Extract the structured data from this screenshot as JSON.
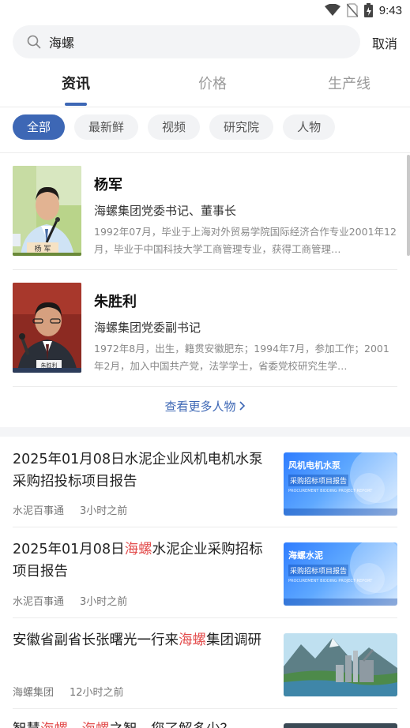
{
  "status_bar": {
    "time": "9:43",
    "icons": [
      "wifi-icon",
      "no-sim-icon",
      "battery-charging-icon"
    ]
  },
  "search": {
    "value": "海螺",
    "cancel_label": "取消"
  },
  "main_tabs": [
    {
      "label": "资讯",
      "active": true
    },
    {
      "label": "价格",
      "active": false
    },
    {
      "label": "生产线",
      "active": false
    }
  ],
  "filter_chips": [
    {
      "label": "全部",
      "active": true
    },
    {
      "label": "最新鲜",
      "active": false
    },
    {
      "label": "视频",
      "active": false
    },
    {
      "label": "研究院",
      "active": false
    },
    {
      "label": "人物",
      "active": false
    }
  ],
  "people": [
    {
      "name": "杨军",
      "title": "海螺集团党委书记、董事长",
      "bio": "1992年07月，毕业于上海对外贸易学院国际经济合作专业2001年12月，毕业于中国科技大学工商管理专业，获得工商管理…",
      "photo_caption": "杨 军"
    },
    {
      "name": "朱胜利",
      "title": "海螺集团党委副书记",
      "bio": "1972年8月，出生，籍贯安徽肥东；1994年7月，参加工作；2001年2月，加入中国共产党，法学学士，省委党校研究生学…",
      "photo_caption": "朱胜利"
    }
  ],
  "more_people_label": "查看更多人物",
  "news": [
    {
      "title_parts": [
        {
          "text": "2025年01月08日水泥企业风机电机水泵采购招投标项目报告",
          "highlight": false
        }
      ],
      "source": "水泥百事通",
      "time": "3小时之前",
      "thumb": {
        "line1": "风机电机水泵",
        "badge": "采购招标项目报告",
        "line3": "PROCUREMENT BIDDING PROJECT REPORT"
      }
    },
    {
      "title_parts": [
        {
          "text": "2025年01月08日",
          "highlight": false
        },
        {
          "text": "海螺",
          "highlight": true
        },
        {
          "text": "水泥企业采购招标项目报告",
          "highlight": false
        }
      ],
      "source": "水泥百事通",
      "time": "3小时之前",
      "thumb": {
        "line1": "海螺水泥",
        "badge": "采购招标项目报告",
        "line3": "PROCUREMENT BIDDING PROJECT REPORT"
      }
    },
    {
      "title_parts": [
        {
          "text": "安徽省副省长张曙光一行来",
          "highlight": false
        },
        {
          "text": "海螺",
          "highlight": true
        },
        {
          "text": "集团调研",
          "highlight": false
        }
      ],
      "source": "海螺集团",
      "time": "12小时之前"
    },
    {
      "title_parts": [
        {
          "text": "智慧",
          "highlight": false
        },
        {
          "text": "海螺",
          "highlight": true
        },
        {
          "text": "，",
          "highlight": false
        },
        {
          "text": "海螺",
          "highlight": true
        },
        {
          "text": "之智，您了解多少？",
          "highlight": false
        }
      ]
    }
  ],
  "colors": {
    "accent": "#3d67b5",
    "highlight": "#e34d4d"
  }
}
